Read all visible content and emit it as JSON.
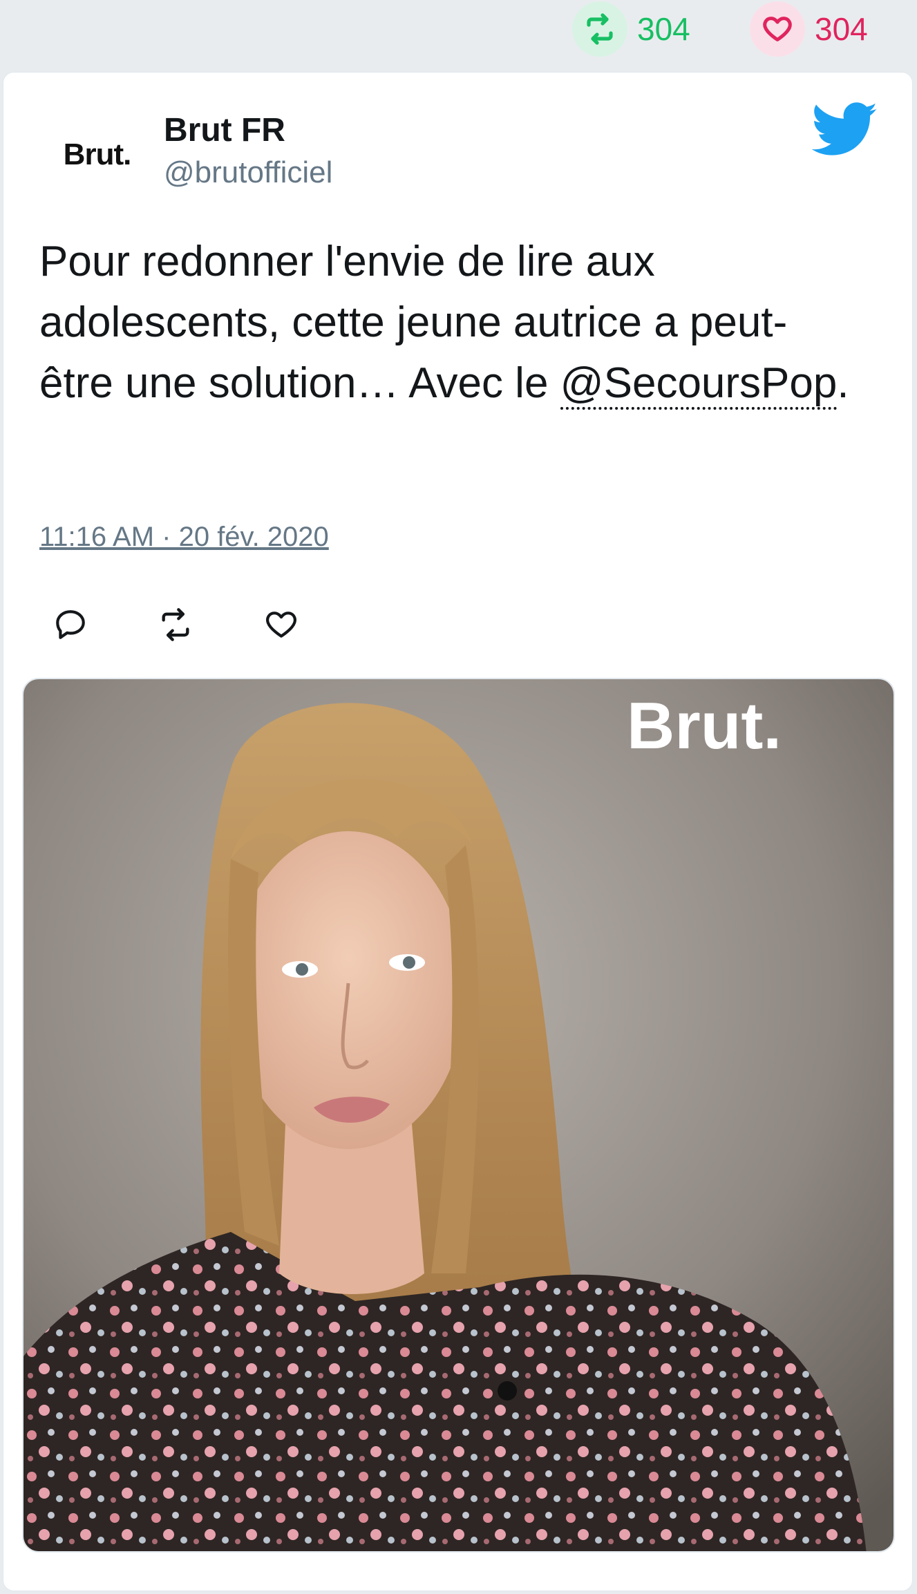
{
  "stats": {
    "retweets": "304",
    "likes": "304"
  },
  "tweet": {
    "avatar_text": "Brut.",
    "display_name": "Brut FR",
    "handle": "@brutofficiel",
    "text_main": "Pour redonner l'envie de lire aux adolescents, cette jeune autrice a peut-être une solution… Avec le ",
    "mention": "@SecoursPop",
    "text_end": ".",
    "timestamp": "11:16 AM · 20 fév. 2020"
  },
  "media": {
    "watermark": "Brut."
  },
  "icons": {
    "retweet": "retweet-icon",
    "like": "heart-icon",
    "reply": "reply-icon",
    "brand": "twitter-bird-icon"
  },
  "colors": {
    "retweet": "#17bf63",
    "like": "#e0245e",
    "brand": "#1da1f2",
    "secondary": "#657786"
  }
}
